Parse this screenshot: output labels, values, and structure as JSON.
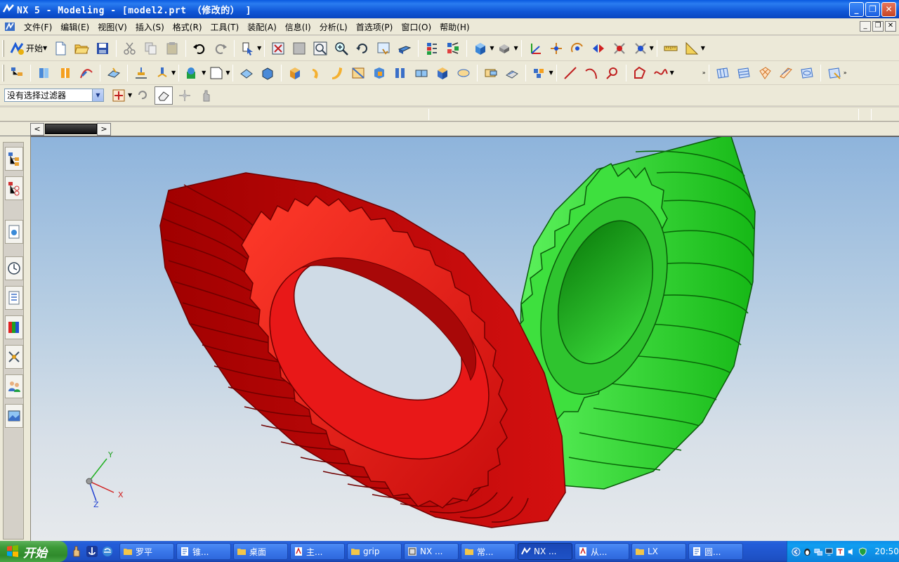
{
  "window": {
    "title": "NX 5 - Modeling - [model2.prt （修改的） ]",
    "minimize_label": "_",
    "maximize_label": "❐",
    "close_label": "✕"
  },
  "menubar": {
    "items": [
      "文件(F)",
      "编辑(E)",
      "视图(V)",
      "插入(S)",
      "格式(R)",
      "工具(T)",
      "装配(A)",
      "信息(I)",
      "分析(L)",
      "首选项(P)",
      "窗口(O)",
      "帮助(H)"
    ]
  },
  "toolbar": {
    "start_label": "开始"
  },
  "selection_bar": {
    "filter_value": "没有选择过滤器"
  },
  "tabstrip": {
    "prev_label": "<",
    "next_label": ">"
  },
  "triad": {
    "x_label": "X",
    "y_label": "Y",
    "z_label": "Z"
  },
  "colors": {
    "gear_red": "#f01818",
    "gear_green": "#20d020",
    "titlebar_blue": "#1158d8"
  },
  "taskbar": {
    "start_label": "开始",
    "tasks": [
      {
        "label": "罗平",
        "icon": "folder-icon"
      },
      {
        "label": "锥...",
        "icon": "document-icon"
      },
      {
        "label": "桌面",
        "icon": "folder-icon"
      },
      {
        "label": "主...",
        "icon": "pdf-icon"
      },
      {
        "label": "grip",
        "icon": "folder-icon"
      },
      {
        "label": "NX ...",
        "icon": "app-icon"
      },
      {
        "label": "常...",
        "icon": "folder-icon"
      },
      {
        "label": "NX ...",
        "icon": "nx-icon"
      },
      {
        "label": "从...",
        "icon": "pdf-icon"
      },
      {
        "label": "LX",
        "icon": "folder-icon"
      },
      {
        "label": "圆...",
        "icon": "document-icon"
      }
    ],
    "clock": "20:50"
  }
}
